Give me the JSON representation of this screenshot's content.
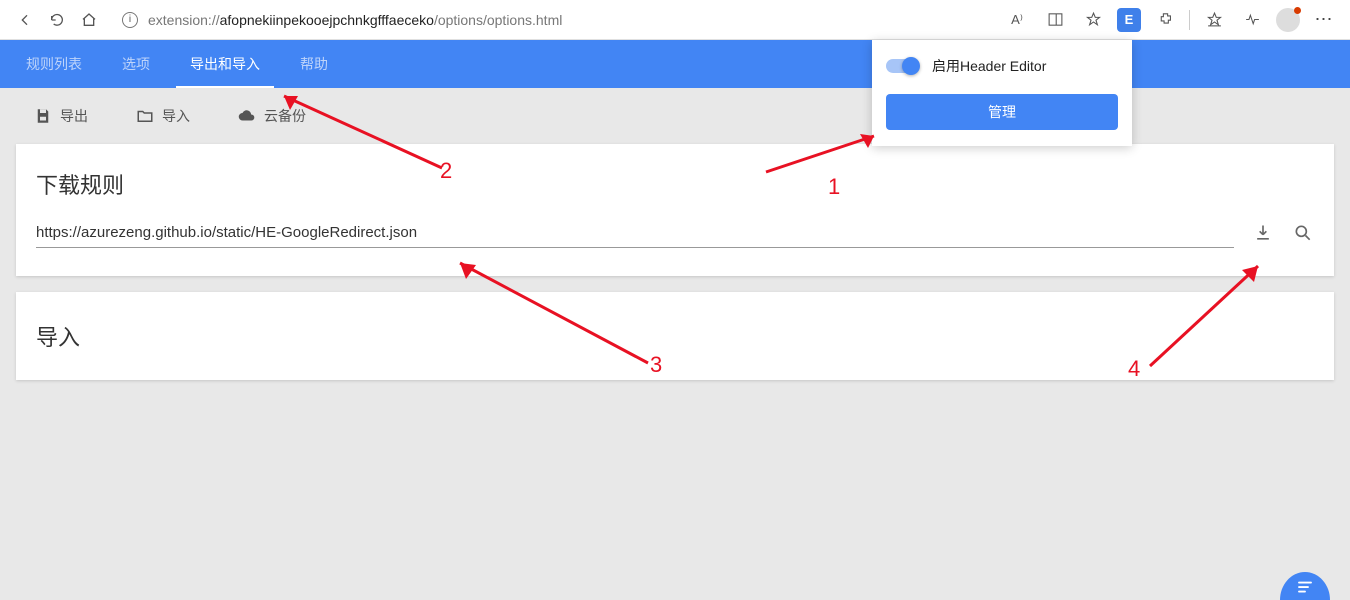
{
  "browser": {
    "url_prefix": "extension://",
    "url_bold": "afopnekiinpekooejpchnkgfffaeceko",
    "url_suffix": "/options/options.html",
    "read_aloud": "A⁾"
  },
  "tabs": {
    "items": [
      {
        "label": "规则列表"
      },
      {
        "label": "选项"
      },
      {
        "label": "导出和导入"
      },
      {
        "label": "帮助"
      }
    ]
  },
  "toolbar": {
    "export": "导出",
    "import": "导入",
    "cloud": "云备份"
  },
  "download_card": {
    "title": "下载规则",
    "url_value": "https://azurezeng.github.io/static/HE-GoogleRedirect.json"
  },
  "import_card": {
    "title": "导入"
  },
  "popup": {
    "enable_label": "启用Header Editor",
    "manage_btn": "管理"
  },
  "annotations": {
    "n1": "1",
    "n2": "2",
    "n3": "3",
    "n4": "4"
  }
}
